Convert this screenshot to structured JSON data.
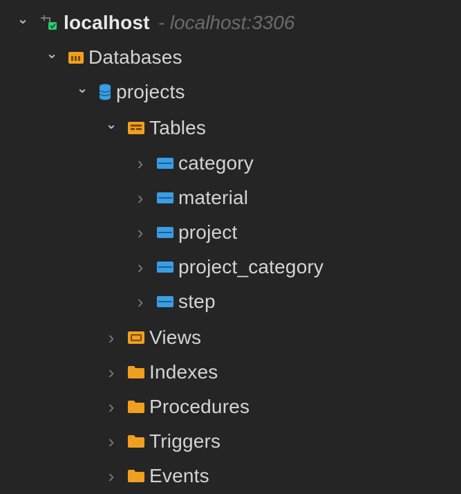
{
  "tree": {
    "host": {
      "label": "localhost",
      "detail": "- localhost:3306",
      "expanded": true
    },
    "databases": {
      "label": "Databases",
      "expanded": true
    },
    "database": {
      "label": "projects",
      "expanded": true
    },
    "tables": {
      "label": "Tables",
      "expanded": true,
      "items": [
        {
          "label": "category"
        },
        {
          "label": "material"
        },
        {
          "label": "project"
        },
        {
          "label": "project_category"
        },
        {
          "label": "step"
        }
      ]
    },
    "groups": [
      {
        "label": "Views"
      },
      {
        "label": "Indexes"
      },
      {
        "label": "Procedures"
      },
      {
        "label": "Triggers"
      },
      {
        "label": "Events"
      }
    ]
  },
  "colors": {
    "background": "#252526",
    "folder": "#f0a020",
    "table": "#3a9ee4",
    "database": "#3a9ee4",
    "host_status": "#2ecc71"
  }
}
